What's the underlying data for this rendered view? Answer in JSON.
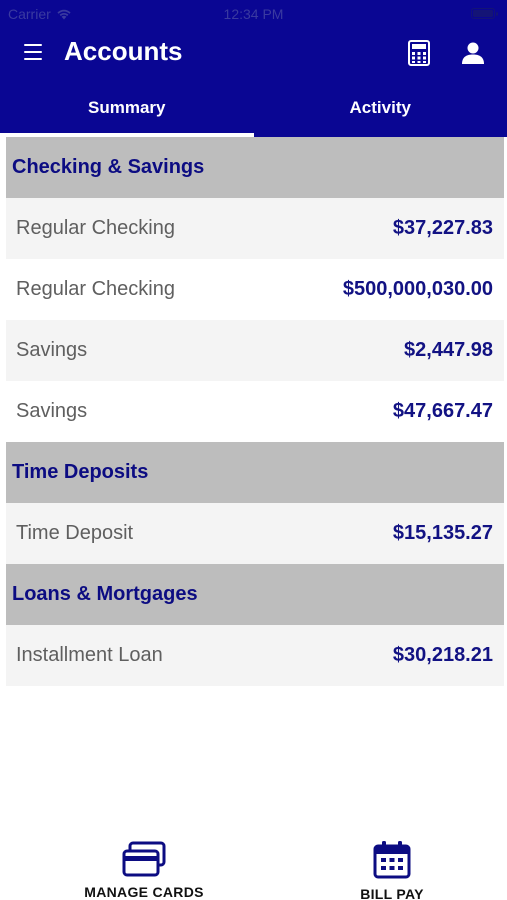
{
  "status_bar": {
    "carrier": "Carrier",
    "time": "12:34 PM"
  },
  "nav": {
    "title": "Accounts",
    "menu_icon": "hamburger-menu-icon",
    "calculator_icon": "calculator-icon",
    "profile_icon": "user-profile-icon"
  },
  "tabs": [
    {
      "label": "Summary",
      "active": true
    },
    {
      "label": "Activity",
      "active": false
    }
  ],
  "sections": [
    {
      "title": "Checking & Savings",
      "accounts": [
        {
          "name": "Regular Checking",
          "amount": "$37,227.83"
        },
        {
          "name": "Regular Checking",
          "amount": "$500,000,030.00"
        },
        {
          "name": "Savings",
          "amount": "$2,447.98"
        },
        {
          "name": "Savings",
          "amount": "$47,667.47"
        }
      ]
    },
    {
      "title": "Time Deposits",
      "accounts": [
        {
          "name": "Time Deposit",
          "amount": "$15,135.27"
        }
      ]
    },
    {
      "title": "Loans & Mortgages",
      "accounts": [
        {
          "name": "Installment Loan",
          "amount": "$30,218.21"
        }
      ]
    }
  ],
  "bottom_bar": {
    "manage_cards": {
      "label": "MANAGE CARDS",
      "icon": "cards-icon"
    },
    "bill_pay": {
      "label": "BILL PAY",
      "icon": "calendar-icon"
    }
  },
  "colors": {
    "brand": "#0a0693",
    "section_header_bg": "#bdbdbd",
    "amount_text": "#121283"
  }
}
